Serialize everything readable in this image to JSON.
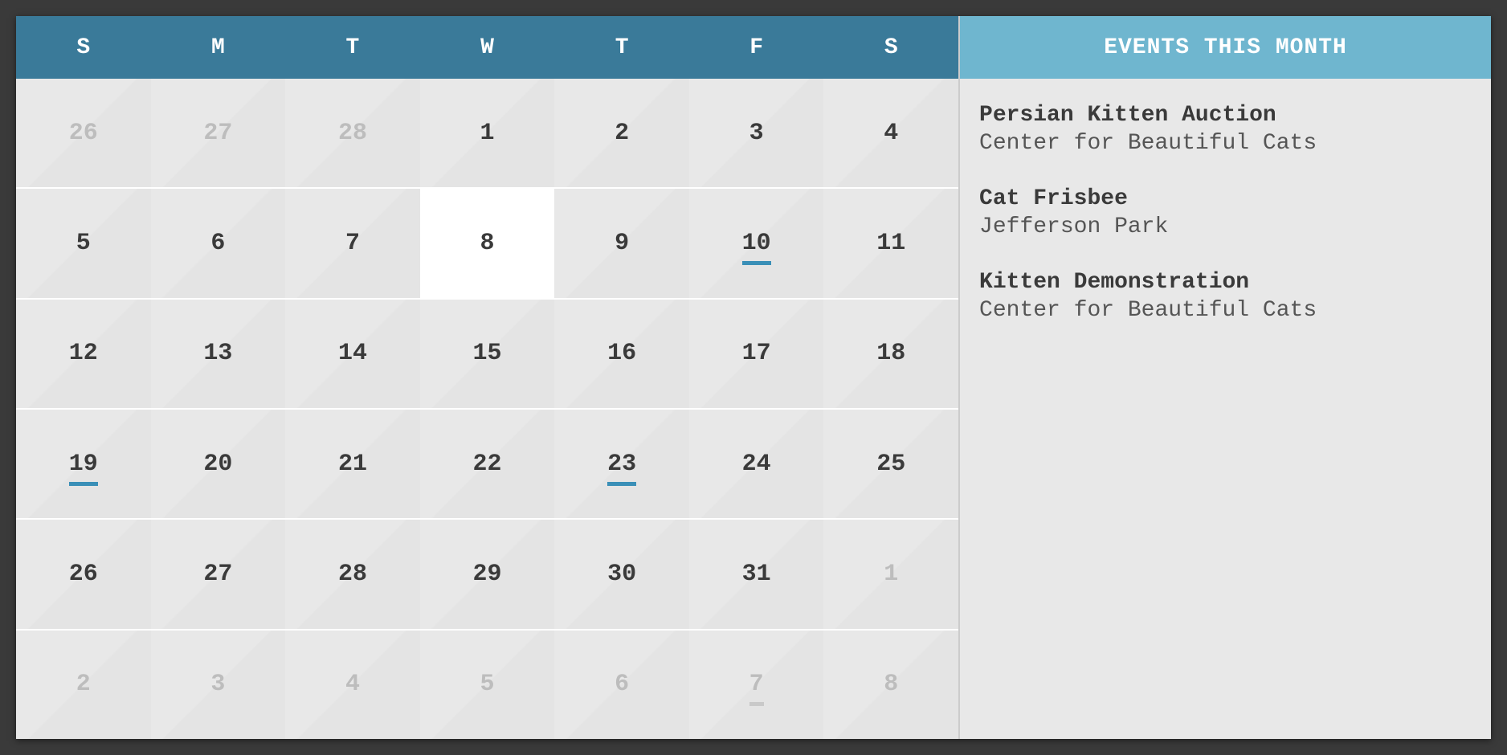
{
  "days_of_week": [
    "S",
    "M",
    "T",
    "W",
    "T",
    "F",
    "S"
  ],
  "events_header": "EVENTS THIS MONTH",
  "weeks": [
    [
      {
        "n": "26",
        "other": true,
        "event": false,
        "today": false
      },
      {
        "n": "27",
        "other": true,
        "event": false,
        "today": false
      },
      {
        "n": "28",
        "other": true,
        "event": false,
        "today": false
      },
      {
        "n": "1",
        "other": false,
        "event": false,
        "today": false
      },
      {
        "n": "2",
        "other": false,
        "event": false,
        "today": false
      },
      {
        "n": "3",
        "other": false,
        "event": false,
        "today": false
      },
      {
        "n": "4",
        "other": false,
        "event": false,
        "today": false
      }
    ],
    [
      {
        "n": "5",
        "other": false,
        "event": false,
        "today": false
      },
      {
        "n": "6",
        "other": false,
        "event": false,
        "today": false
      },
      {
        "n": "7",
        "other": false,
        "event": false,
        "today": false
      },
      {
        "n": "8",
        "other": false,
        "event": false,
        "today": true
      },
      {
        "n": "9",
        "other": false,
        "event": false,
        "today": false
      },
      {
        "n": "10",
        "other": false,
        "event": true,
        "today": false
      },
      {
        "n": "11",
        "other": false,
        "event": false,
        "today": false
      }
    ],
    [
      {
        "n": "12",
        "other": false,
        "event": false,
        "today": false
      },
      {
        "n": "13",
        "other": false,
        "event": false,
        "today": false
      },
      {
        "n": "14",
        "other": false,
        "event": false,
        "today": false
      },
      {
        "n": "15",
        "other": false,
        "event": false,
        "today": false
      },
      {
        "n": "16",
        "other": false,
        "event": false,
        "today": false
      },
      {
        "n": "17",
        "other": false,
        "event": false,
        "today": false
      },
      {
        "n": "18",
        "other": false,
        "event": false,
        "today": false
      }
    ],
    [
      {
        "n": "19",
        "other": false,
        "event": true,
        "today": false
      },
      {
        "n": "20",
        "other": false,
        "event": false,
        "today": false
      },
      {
        "n": "21",
        "other": false,
        "event": false,
        "today": false
      },
      {
        "n": "22",
        "other": false,
        "event": false,
        "today": false
      },
      {
        "n": "23",
        "other": false,
        "event": true,
        "today": false
      },
      {
        "n": "24",
        "other": false,
        "event": false,
        "today": false
      },
      {
        "n": "25",
        "other": false,
        "event": false,
        "today": false
      }
    ],
    [
      {
        "n": "26",
        "other": false,
        "event": false,
        "today": false
      },
      {
        "n": "27",
        "other": false,
        "event": false,
        "today": false
      },
      {
        "n": "28",
        "other": false,
        "event": false,
        "today": false
      },
      {
        "n": "29",
        "other": false,
        "event": false,
        "today": false
      },
      {
        "n": "30",
        "other": false,
        "event": false,
        "today": false
      },
      {
        "n": "31",
        "other": false,
        "event": false,
        "today": false
      },
      {
        "n": "1",
        "other": true,
        "event": false,
        "today": false
      }
    ],
    [
      {
        "n": "2",
        "other": true,
        "event": false,
        "today": false
      },
      {
        "n": "3",
        "other": true,
        "event": false,
        "today": false
      },
      {
        "n": "4",
        "other": true,
        "event": false,
        "today": false
      },
      {
        "n": "5",
        "other": true,
        "event": false,
        "today": false
      },
      {
        "n": "6",
        "other": true,
        "event": false,
        "today": false
      },
      {
        "n": "7",
        "other": true,
        "event": true,
        "today": false
      },
      {
        "n": "8",
        "other": true,
        "event": false,
        "today": false
      }
    ]
  ],
  "events": [
    {
      "title": "Persian Kitten Auction",
      "location": "Center for Beautiful Cats"
    },
    {
      "title": "Cat Frisbee",
      "location": "Jefferson Park"
    },
    {
      "title": "Kitten Demonstration",
      "location": "Center for Beautiful Cats"
    }
  ]
}
